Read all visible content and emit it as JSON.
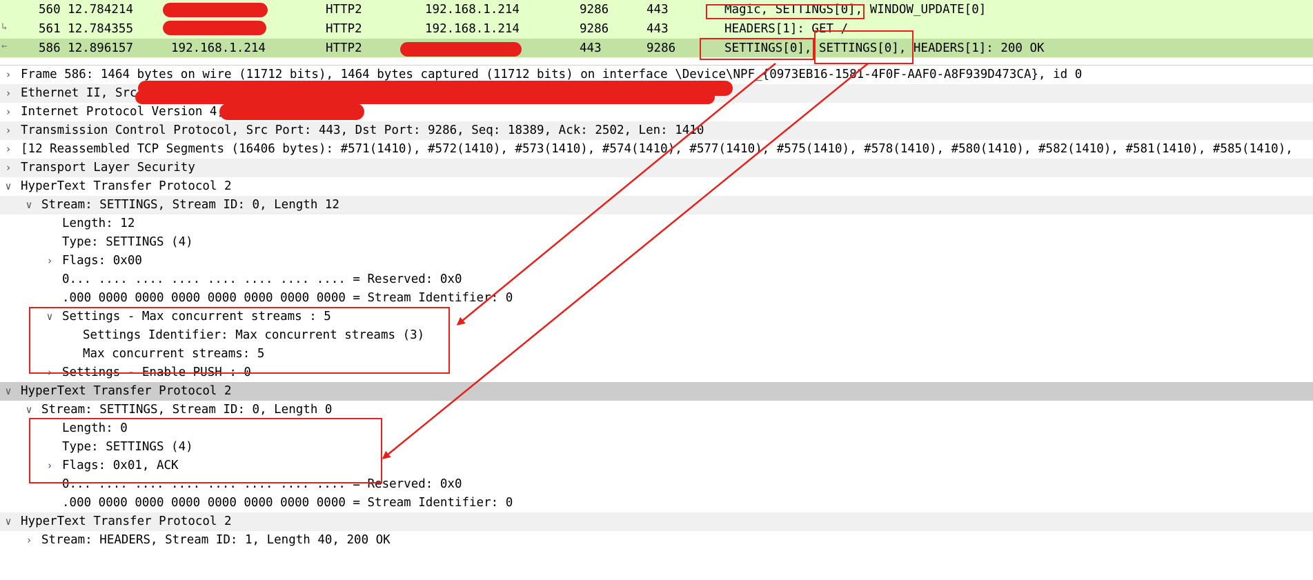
{
  "packet_list": {
    "rows": [
      {
        "no": "560",
        "time": "12.784214",
        "src": "",
        "proto": "HTTP2",
        "dst": "192.168.1.214",
        "sport": "9286",
        "dport": "443",
        "info": "Magic, SETTINGS[0], WINDOW_UPDATE[0]"
      },
      {
        "no": "561",
        "time": "12.784355",
        "src": "",
        "proto": "HTTP2",
        "dst": "192.168.1.214",
        "sport": "9286",
        "dport": "443",
        "info": "HEADERS[1]: GET /"
      },
      {
        "no": "586",
        "time": "12.896157",
        "src": "192.168.1.214",
        "proto": "HTTP2",
        "dst": "",
        "sport": "443",
        "dport": "9286",
        "info": "SETTINGS[0], SETTINGS[0], HEADERS[1]: 200 OK"
      }
    ]
  },
  "detail_tree": {
    "rows": [
      {
        "text": "Frame 586: 1464 bytes on wire (11712 bits), 1464 bytes captured (11712 bits) on interface \\Device\\NPF_{0973EB16-1581-4F0F-AAF0-A8F939D473CA}, id 0",
        "expander": "collapsed"
      },
      {
        "text": "Ethernet II, Src",
        "expander": "collapsed"
      },
      {
        "text": "Internet Protocol Version 4,                 Dst: 192.168.1.214",
        "expander": "collapsed"
      },
      {
        "text": "Transmission Control Protocol, Src Port: 443, Dst Port: 9286, Seq: 18389, Ack: 2502, Len: 1410",
        "expander": "collapsed"
      },
      {
        "text": "[12 Reassembled TCP Segments (16406 bytes): #571(1410), #572(1410), #573(1410), #574(1410), #577(1410), #575(1410), #578(1410), #580(1410), #582(1410), #581(1410), #585(1410),",
        "expander": "collapsed"
      },
      {
        "text": "Transport Layer Security",
        "expander": "collapsed"
      },
      {
        "text": "HyperText Transfer Protocol 2",
        "expander": "expanded"
      },
      {
        "text": "Stream: SETTINGS, Stream ID: 0, Length 12",
        "expander": "expanded"
      },
      {
        "text": "Length: 12",
        "expander": "none"
      },
      {
        "text": "Type: SETTINGS (4)",
        "expander": "none"
      },
      {
        "text": "Flags: 0x00",
        "expander": "collapsed"
      },
      {
        "text": "0... .... .... .... .... .... .... .... = Reserved: 0x0",
        "expander": "none"
      },
      {
        "text": ".000 0000 0000 0000 0000 0000 0000 0000 = Stream Identifier: 0",
        "expander": "none"
      },
      {
        "text": "Settings - Max concurrent streams : 5",
        "expander": "expanded"
      },
      {
        "text": "Settings Identifier: Max concurrent streams (3)",
        "expander": "none"
      },
      {
        "text": "Max concurrent streams: 5",
        "expander": "none"
      },
      {
        "text": "Settings - Enable PUSH : 0",
        "expander": "collapsed"
      },
      {
        "text": "HyperText Transfer Protocol 2",
        "expander": "expanded"
      },
      {
        "text": "Stream: SETTINGS, Stream ID: 0, Length 0",
        "expander": "expanded"
      },
      {
        "text": "Length: 0",
        "expander": "none"
      },
      {
        "text": "Type: SETTINGS (4)",
        "expander": "none"
      },
      {
        "text": "Flags: 0x01, ACK",
        "expander": "collapsed"
      },
      {
        "text": "0... .... .... .... .... .... .... .... = Reserved: 0x0",
        "expander": "none"
      },
      {
        "text": ".000 0000 0000 0000 0000 0000 0000 0000 = Stream Identifier: 0",
        "expander": "none"
      },
      {
        "text": "HyperText Transfer Protocol 2",
        "expander": "expanded"
      },
      {
        "text": "Stream: HEADERS, Stream ID: 1, Length 40, 200 OK",
        "expander": "collapsed"
      }
    ]
  },
  "colors": {
    "packet_bg": "#e4ffc7",
    "selected_packet_bg": "#c2e2a4",
    "annotation_red": "#e8201c",
    "band_bg": "#f0f0f0",
    "selected_tree_bg": "#cccccc"
  },
  "icons": {
    "collapsed": "chevron-right-icon",
    "expanded": "chevron-down-icon"
  }
}
